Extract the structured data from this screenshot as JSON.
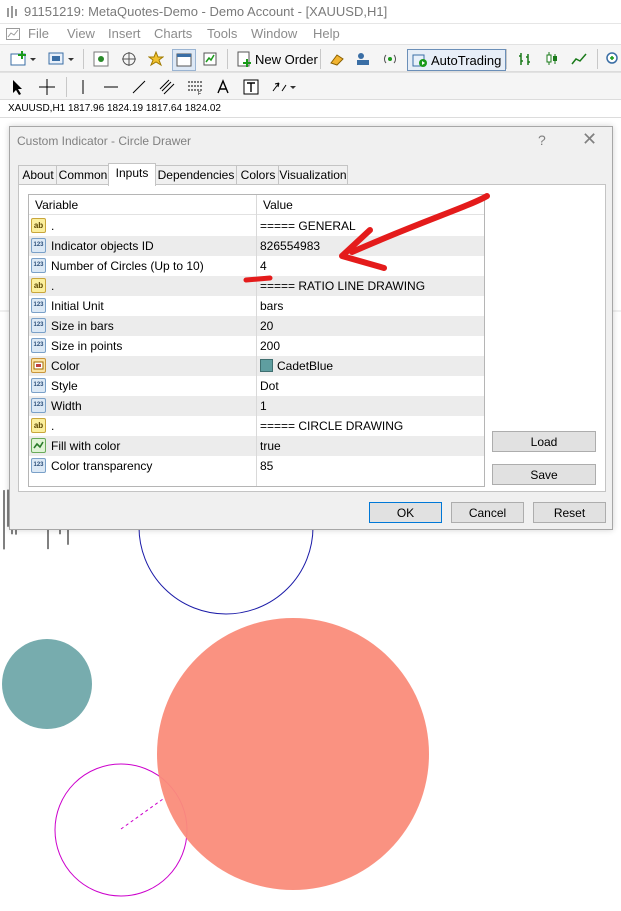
{
  "window": {
    "title": "91151219: MetaQuotes-Demo - Demo Account - [XAUUSD,H1]"
  },
  "menu": [
    "File",
    "View",
    "Insert",
    "Charts",
    "Tools",
    "Window",
    "Help"
  ],
  "toolbar": {
    "new_order": "New Order",
    "autotrading": "AutoTrading"
  },
  "chart": {
    "info": "XAUUSD,H1  1817.96 1824.19 1817.64 1824.02"
  },
  "dialog": {
    "title": "Custom Indicator - Circle Drawer",
    "help": "?",
    "close": "✕",
    "tabs": [
      "About",
      "Common",
      "Inputs",
      "Dependencies",
      "Colors",
      "Visualization"
    ],
    "active_tab": "Inputs",
    "columns": [
      "Variable",
      "Value"
    ],
    "rows": [
      {
        "type": "string",
        "variable": ".",
        "value": "===== GENERAL"
      },
      {
        "type": "int",
        "variable": "Indicator objects ID",
        "value": "826554983"
      },
      {
        "type": "int",
        "variable": "Number of Circles (Up to 10)",
        "value": "4"
      },
      {
        "type": "string",
        "variable": ".",
        "value": "===== RATIO LINE DRAWING"
      },
      {
        "type": "int",
        "variable": "Initial Unit",
        "value": "bars"
      },
      {
        "type": "int",
        "variable": "Size in bars",
        "value": "20"
      },
      {
        "type": "int",
        "variable": "Size in points",
        "value": "200"
      },
      {
        "type": "color",
        "variable": "Color",
        "value": "CadetBlue"
      },
      {
        "type": "int",
        "variable": "Style",
        "value": "Dot"
      },
      {
        "type": "int",
        "variable": "Width",
        "value": "1"
      },
      {
        "type": "string",
        "variable": ".",
        "value": "===== CIRCLE DRAWING"
      },
      {
        "type": "bool",
        "variable": "Fill with color",
        "value": "true"
      },
      {
        "type": "int",
        "variable": "Color transparency",
        "value": "85"
      }
    ],
    "buttons": {
      "load": "Load",
      "save": "Save",
      "ok": "OK",
      "cancel": "Cancel",
      "reset": "Reset"
    }
  },
  "colors": {
    "cadet_blue": "#5f9ea0",
    "salmon_fill": "#fa8c7a",
    "annotation_red": "#e41b1b",
    "navy_outline": "#1c1ca8",
    "magenta_outline": "#cc00cc"
  }
}
